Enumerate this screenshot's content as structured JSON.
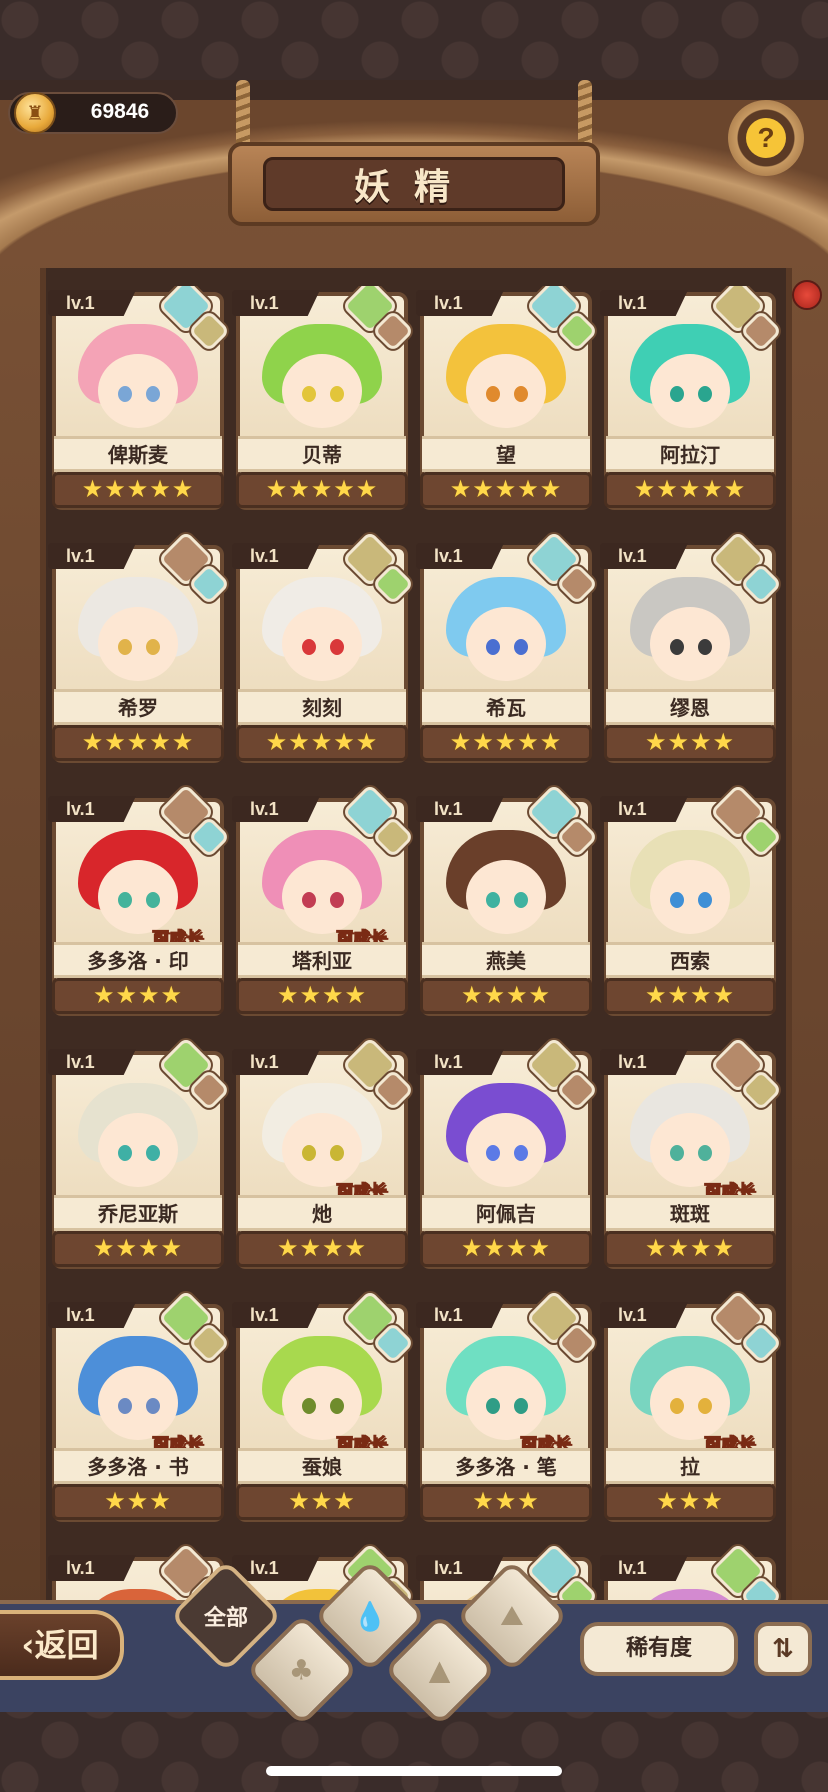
{
  "header": {
    "coins": "69846",
    "title": "妖精",
    "help_icon": "question-sprout-icon",
    "coin_icon": "coin-castle-icon"
  },
  "colors": {
    "water": "#8ed3d4",
    "earth": "#c9b87a",
    "plant": "#9ed26e",
    "mountain": "#b58a6a",
    "star": "#ffd84a"
  },
  "cards": [
    {
      "level": "lv.1",
      "name": "俾斯麦",
      "stars": "★★★★★",
      "grow": "",
      "main": "water",
      "sub": "earth",
      "hair": "#f4a3b6",
      "eye": "#7aa6d6"
    },
    {
      "level": "lv.1",
      "name": "贝蒂",
      "stars": "★★★★★",
      "grow": "",
      "main": "plant",
      "sub": "mountain",
      "hair": "#8fd34b",
      "eye": "#e2c53a"
    },
    {
      "level": "lv.1",
      "name": "望",
      "stars": "★★★★★",
      "grow": "",
      "main": "water",
      "sub": "plant",
      "hair": "#f3c23c",
      "eye": "#e08a2d"
    },
    {
      "level": "lv.1",
      "name": "阿拉汀",
      "stars": "★★★★★",
      "grow": "",
      "main": "earth",
      "sub": "mountain",
      "hair": "#3fcfb4",
      "eye": "#2aa58f"
    },
    {
      "level": "lv.1",
      "name": "希罗",
      "stars": "★★★★★",
      "grow": "",
      "main": "mountain",
      "sub": "water",
      "hair": "#ece8e2",
      "eye": "#e1b34a"
    },
    {
      "level": "lv.1",
      "name": "刻刻",
      "stars": "★★★★★",
      "grow": "",
      "main": "earth",
      "sub": "plant",
      "hair": "#f0ece6",
      "eye": "#d9383a"
    },
    {
      "level": "lv.1",
      "name": "希瓦",
      "stars": "★★★★★",
      "grow": "",
      "main": "water",
      "sub": "mountain",
      "hair": "#7fcaef",
      "eye": "#4a6fd1"
    },
    {
      "level": "lv.1",
      "name": "缪恩",
      "stars": "★★★★",
      "grow": "",
      "main": "earth",
      "sub": "water",
      "hair": "#c9c7c2",
      "eye": "#3b3b3b"
    },
    {
      "level": "lv.1",
      "name": "多多洛 · 印",
      "stars": "★★★★",
      "grow": "可成长",
      "main": "mountain",
      "sub": "water",
      "hair": "#d8262b",
      "eye": "#44b39b"
    },
    {
      "level": "lv.1",
      "name": "塔利亚",
      "stars": "★★★★",
      "grow": "可成长",
      "main": "water",
      "sub": "earth",
      "hair": "#ef8fb7",
      "eye": "#c23d53"
    },
    {
      "level": "lv.1",
      "name": "燕美",
      "stars": "★★★★",
      "grow": "",
      "main": "water",
      "sub": "mountain",
      "hair": "#6a3f2a",
      "eye": "#3fb2a0"
    },
    {
      "level": "lv.1",
      "name": "西索",
      "stars": "★★★★",
      "grow": "",
      "main": "mountain",
      "sub": "plant",
      "hair": "#e8e0b6",
      "eye": "#3e8fd6"
    },
    {
      "level": "lv.1",
      "name": "乔尼亚斯",
      "stars": "★★★★",
      "grow": "",
      "main": "plant",
      "sub": "mountain",
      "hair": "#e6e2cf",
      "eye": "#3fb0a5"
    },
    {
      "level": "lv.1",
      "name": "灺",
      "stars": "★★★★",
      "grow": "可成长",
      "main": "earth",
      "sub": "mountain",
      "hair": "#f2ede2",
      "eye": "#c9b634"
    },
    {
      "level": "lv.1",
      "name": "阿佩吉",
      "stars": "★★★★",
      "grow": "",
      "main": "earth",
      "sub": "mountain",
      "hair": "#7a4dd1",
      "eye": "#5b7ae6"
    },
    {
      "level": "lv.1",
      "name": "斑斑",
      "stars": "★★★★",
      "grow": "可成长",
      "main": "mountain",
      "sub": "earth",
      "hair": "#e9e6e0",
      "eye": "#4fb19b"
    },
    {
      "level": "lv.1",
      "name": "多多洛 · 书",
      "stars": "★★★",
      "grow": "可成长",
      "main": "plant",
      "sub": "earth",
      "hair": "#4d8fd9",
      "eye": "#6b8ac3"
    },
    {
      "level": "lv.1",
      "name": "蚕娘",
      "stars": "★★★",
      "grow": "可成长",
      "main": "plant",
      "sub": "water",
      "hair": "#a8d94e",
      "eye": "#6f8c2c"
    },
    {
      "level": "lv.1",
      "name": "多多洛 · 笔",
      "stars": "★★★",
      "grow": "可成长",
      "main": "earth",
      "sub": "mountain",
      "hair": "#6fdfc2",
      "eye": "#2f9d86"
    },
    {
      "level": "lv.1",
      "name": "拉",
      "stars": "★★★",
      "grow": "可成长",
      "main": "mountain",
      "sub": "water",
      "hair": "#79d5c0",
      "eye": "#e3b13c"
    },
    {
      "level": "lv.1",
      "name": "",
      "stars": "",
      "grow": "",
      "main": "mountain",
      "sub": "earth",
      "hair": "#d9643a",
      "eye": "#333333"
    },
    {
      "level": "lv.1",
      "name": "",
      "stars": "",
      "grow": "",
      "main": "plant",
      "sub": "earth",
      "hair": "#f2c23a",
      "eye": "#333333"
    },
    {
      "level": "lv.1",
      "name": "",
      "stars": "",
      "grow": "",
      "main": "water",
      "sub": "plant",
      "hair": "#e3c48a",
      "eye": "#333333"
    },
    {
      "level": "lv.1",
      "name": "",
      "stars": "",
      "grow": "",
      "main": "plant",
      "sub": "water",
      "hair": "#d38ad0",
      "eye": "#333333"
    }
  ],
  "footer": {
    "back_label": "返回",
    "filter_all_label": "全部",
    "sort_label": "稀有度",
    "filters": [
      "water-icon",
      "plant-icon",
      "earth-icon",
      "mountain-icon"
    ]
  }
}
